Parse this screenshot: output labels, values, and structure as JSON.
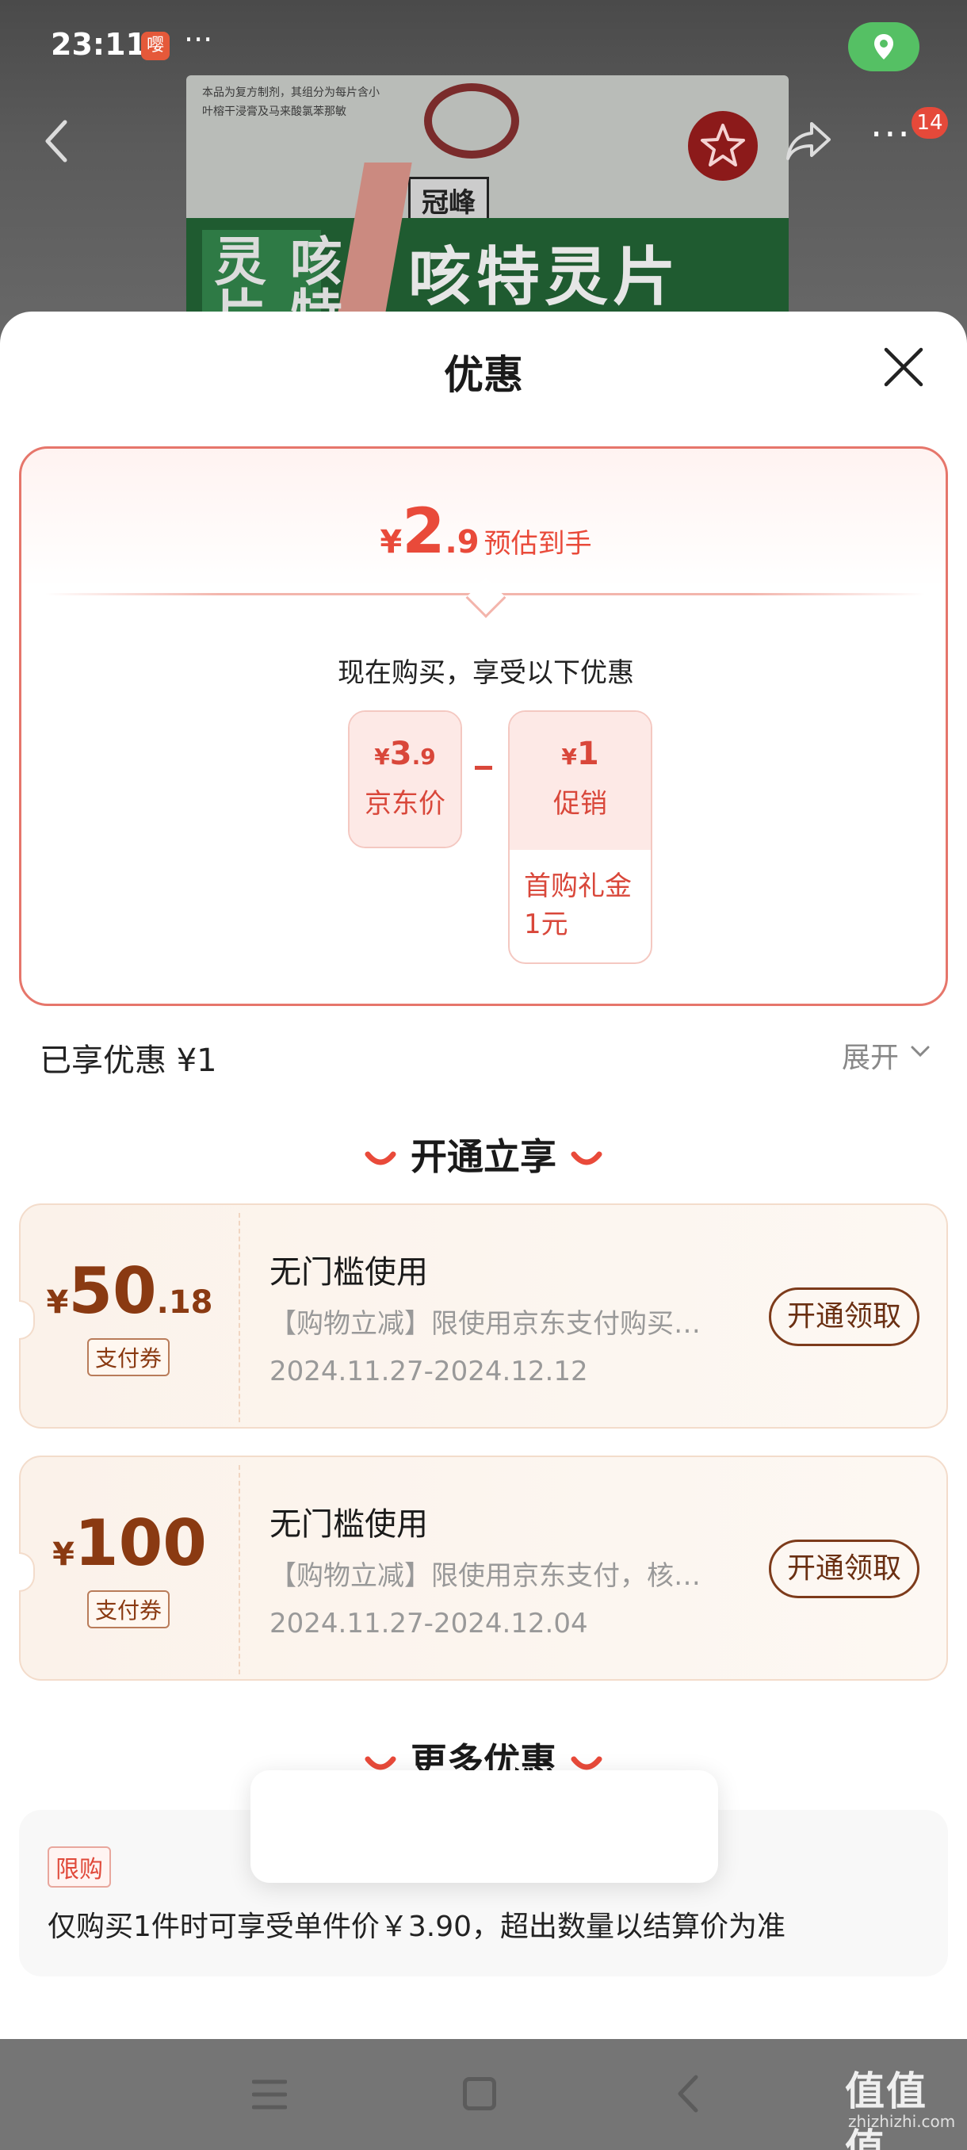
{
  "status_bar": {
    "time": "23:11",
    "app_badge": "嘤",
    "more": "···"
  },
  "product_bg": {
    "brand": "冠峰",
    "product_name": "咳特灵片",
    "side_name": "咳特灵片",
    "fine_print": "本品为复方制剂，其组分为每片含小叶榕干浸膏及马来酸氯苯那敏"
  },
  "nav": {
    "cart_count": "14"
  },
  "sheet": {
    "title": "优惠",
    "estimate": {
      "currency": "¥",
      "integer": "2",
      "decimal": ".9",
      "label": "预估到手"
    },
    "now_buy": "现在购买，享受以下优惠",
    "jd_price": {
      "currency": "¥",
      "integer": "3",
      "decimal": ".9",
      "label": "京东价"
    },
    "promo": {
      "currency": "¥",
      "integer": "1",
      "label": "促销",
      "note": "首购礼金1元"
    },
    "enjoyed": "已享优惠 ¥1",
    "expand": "展开",
    "open_section": "开通立享",
    "coupons": [
      {
        "currency": "¥",
        "integer": "50",
        "decimal": ".18",
        "tag": "支付券",
        "title": "无门槛使用",
        "desc": "【购物立减】限使用京东支付购买…",
        "date": "2024.11.27-2024.12.12",
        "button": "开通领取"
      },
      {
        "currency": "¥",
        "integer": "100",
        "decimal": "",
        "tag": "支付券",
        "title": "无门槛使用",
        "desc": "【购物立减】限使用京东支付，核…",
        "date": "2024.11.27-2024.12.04",
        "button": "开通领取"
      }
    ],
    "more_section": "更多优惠",
    "limit_tag": "限购",
    "limit_text": "仅购买1件时可享受单件价￥3.90，超出数量以结算价为准"
  },
  "watermark": {
    "main": "值值值",
    "sub": "zhizhizhi.com"
  },
  "colors": {
    "accent_red": "#e94a3a",
    "coupon_brown": "#8a3a12",
    "location_green": "#55c064"
  }
}
